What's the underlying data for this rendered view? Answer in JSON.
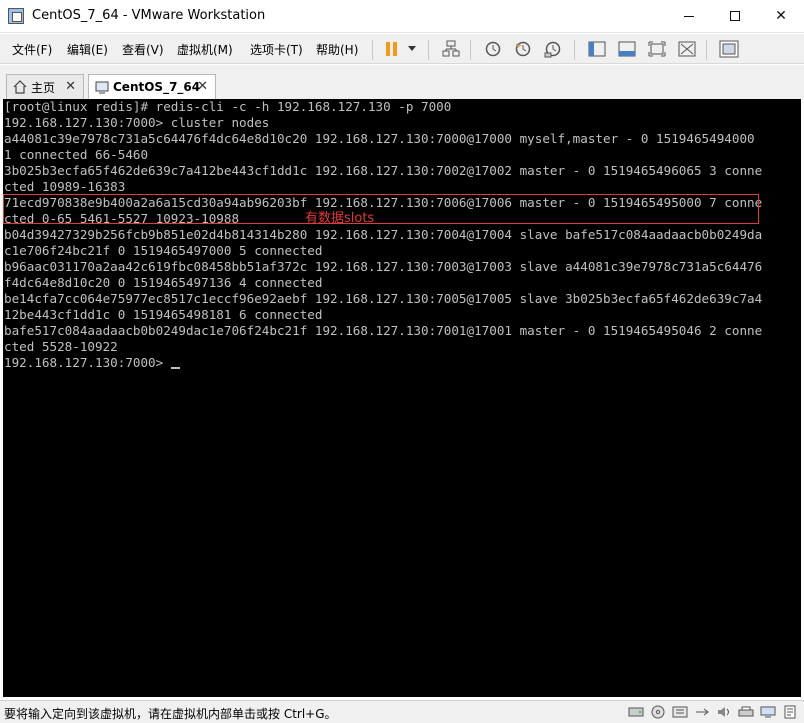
{
  "window": {
    "title": "CentOS_7_64 - VMware Workstation",
    "minimize": "—",
    "close": "✕"
  },
  "menu": {
    "file": "文件(F)",
    "edit": "编辑(E)",
    "view": "查看(V)",
    "vm": "虚拟机(M)",
    "tabs": "选项卡(T)",
    "help": "帮助(H)"
  },
  "tabs": [
    {
      "label": "主页"
    },
    {
      "label": "CentOS_7_64",
      "close": "✕"
    }
  ],
  "console": {
    "lines": [
      "[root@linux redis]# redis-cli -c -h 192.168.127.130 -p 7000",
      "192.168.127.130:7000> cluster nodes",
      "a44081c39e7978c731a5c64476f4dc64e8d10c20 192.168.127.130:7000@17000 myself,master - 0 1519465494000",
      "1 connected 66-5460",
      "3b025b3ecfa65f462de639c7a412be443cf1dd1c 192.168.127.130:7002@17002 master - 0 1519465496065 3 conne",
      "cted 10989-16383",
      "71ecd970838e9b400a2a6a15cd30a94ab96203bf 192.168.127.130:7006@17006 master - 0 1519465495000 7 conne",
      "cted 0-65 5461-5527 10923-10988",
      "b04d39427329b256fcb9b851e02d4b814314b280 192.168.127.130:7004@17004 slave bafe517c084aadaacb0b0249da",
      "c1e706f24bc21f 0 1519465497000 5 connected",
      "b96aac031170a2aa42c619fbc08458bb51af372c 192.168.127.130:7003@17003 slave a44081c39e7978c731a5c64476",
      "f4dc64e8d10c20 0 1519465497136 4 connected",
      "be14cfa7cc064e75977ec8517c1eccf96e92aebf 192.168.127.130:7005@17005 slave 3b025b3ecfa65f462de639c7a4",
      "12be443cf1dd1c 0 1519465498181 6 connected",
      "bafe517c084aadaacb0b0249dac1e706f24bc21f 192.168.127.130:7001@17001 master - 0 1519465495046 2 conne",
      "cted 5528-10922",
      "192.168.127.130:7000> "
    ],
    "annotation": "有数据slots"
  },
  "status": {
    "message": "要将输入定向到该虚拟机，请在虚拟机内部单击或按 Ctrl+G。"
  },
  "colors": {
    "console_bg": "#000000",
    "console_fg": "#c0c0c0",
    "annotation": "#e03a3a",
    "pause_accent": "#f29a1b"
  }
}
